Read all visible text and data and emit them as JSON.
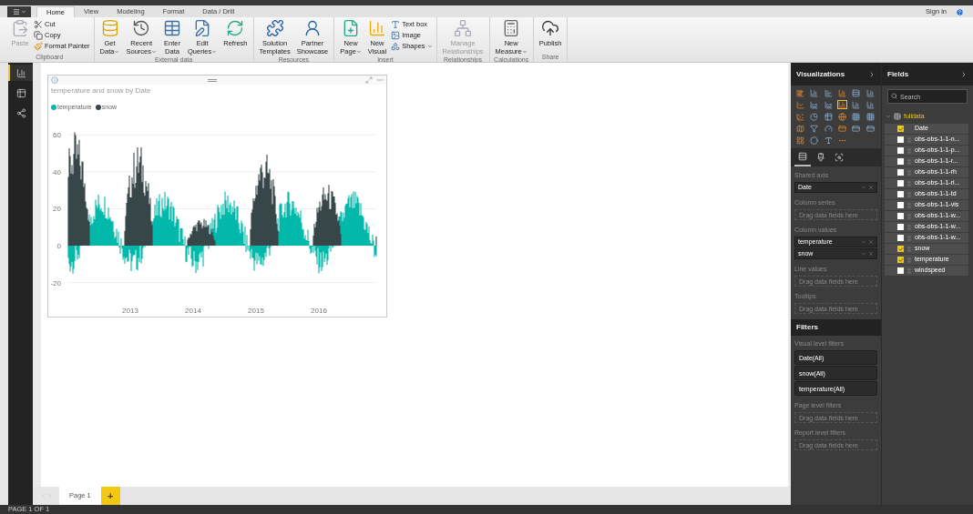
{
  "title_bar": {
    "sign_in": "Sign in"
  },
  "tabs": [
    {
      "label": "Home",
      "selected": true
    },
    {
      "label": "View",
      "selected": false
    },
    {
      "label": "Modeling",
      "selected": false
    },
    {
      "label": "Format",
      "selected": false
    },
    {
      "label": "Data / Drill",
      "selected": false
    }
  ],
  "ribbon": [
    {
      "label": "Clipboard",
      "items": [
        {
          "kind": "large",
          "lines": [
            "Paste"
          ],
          "dropdown": false,
          "disabled": true
        },
        {
          "kind": "small",
          "lines": [
            "Cut"
          ],
          "dropdown": false,
          "disabled": false
        },
        {
          "kind": "small",
          "lines": [
            "Copy"
          ],
          "dropdown": false,
          "disabled": false
        },
        {
          "kind": "small",
          "lines": [
            "Format Painter"
          ],
          "dropdown": false,
          "disabled": false
        }
      ]
    },
    {
      "label": "External data",
      "items": [
        {
          "kind": "large",
          "lines": [
            "Get",
            "Data"
          ],
          "dropdown": true,
          "disabled": false
        },
        {
          "kind": "large",
          "lines": [
            "Recent",
            "Sources"
          ],
          "dropdown": true,
          "disabled": false
        },
        {
          "kind": "large",
          "lines": [
            "Enter",
            "Data"
          ],
          "dropdown": false,
          "disabled": false
        },
        {
          "kind": "large",
          "lines": [
            "Edit",
            "Queries"
          ],
          "dropdown": true,
          "disabled": false
        },
        {
          "kind": "large",
          "lines": [
            "Refresh"
          ],
          "dropdown": false,
          "disabled": false
        }
      ]
    },
    {
      "label": "Resources",
      "items": [
        {
          "kind": "large",
          "lines": [
            "Solution",
            "Templates"
          ],
          "dropdown": false,
          "disabled": false
        },
        {
          "kind": "large",
          "lines": [
            "Partner",
            "Showcase"
          ],
          "dropdown": false,
          "disabled": false
        }
      ]
    },
    {
      "label": "Insert",
      "items": [
        {
          "kind": "large",
          "lines": [
            "New",
            "Page"
          ],
          "dropdown": true,
          "disabled": false
        },
        {
          "kind": "large",
          "lines": [
            "New",
            "Visual"
          ],
          "dropdown": false,
          "disabled": false
        },
        {
          "kind": "small",
          "lines": [
            "Text box"
          ],
          "dropdown": false,
          "disabled": false
        },
        {
          "kind": "small",
          "lines": [
            "Image"
          ],
          "dropdown": false,
          "disabled": false
        },
        {
          "kind": "small",
          "lines": [
            "Shapes"
          ],
          "dropdown": true,
          "disabled": false
        }
      ]
    },
    {
      "label": "Relationships",
      "items": [
        {
          "kind": "large",
          "lines": [
            "Manage",
            "Relationships"
          ],
          "dropdown": false,
          "disabled": true
        }
      ]
    },
    {
      "label": "Calculations",
      "items": [
        {
          "kind": "large",
          "lines": [
            "New",
            "Measure"
          ],
          "dropdown": true,
          "disabled": false
        }
      ]
    },
    {
      "label": "Share",
      "items": [
        {
          "kind": "large",
          "lines": [
            "Publish"
          ],
          "dropdown": false,
          "disabled": false
        }
      ]
    }
  ],
  "views": [
    {
      "selected": true
    },
    {
      "selected": false
    },
    {
      "selected": false
    }
  ],
  "visual": {
    "title": "temperature and snow by Date",
    "legend": [
      {
        "name": "temperature",
        "color": "#01b8aa"
      },
      {
        "name": "snow",
        "color": "#374649"
      }
    ],
    "yticks": [
      "60",
      "40",
      "20",
      "0",
      "-20"
    ],
    "xticks": [
      "2013",
      "2014",
      "2015",
      "2016"
    ]
  },
  "page_tabs": [
    {
      "label": "Page 1",
      "selected": true
    }
  ],
  "add_page": "+",
  "status_bar": "PAGE 1 OF 1",
  "visualizations": {
    "title": "Visualizations",
    "visual_types": [
      {
        "selected": false
      },
      {
        "selected": false
      },
      {
        "selected": false
      },
      {
        "selected": false
      },
      {
        "selected": false
      },
      {
        "selected": false
      },
      {
        "selected": false
      },
      {
        "selected": false
      },
      {
        "selected": false
      },
      {
        "selected": true
      },
      {
        "selected": false
      },
      {
        "selected": false
      },
      {
        "selected": false
      },
      {
        "selected": false
      },
      {
        "selected": false
      },
      {
        "selected": false
      },
      {
        "selected": false
      },
      {
        "selected": false
      },
      {
        "selected": false
      },
      {
        "selected": false
      },
      {
        "selected": false
      },
      {
        "selected": false
      },
      {
        "selected": false
      },
      {
        "selected": false
      },
      {
        "selected": false
      },
      {
        "selected": false
      },
      {
        "selected": false
      },
      {
        "selected": false
      }
    ],
    "pane_tabs": [
      {
        "selected": true
      },
      {
        "selected": false
      },
      {
        "selected": false
      }
    ],
    "wells": [
      {
        "label": "Shared axis",
        "fields": [
          "Date"
        ]
      },
      {
        "label": "Column series",
        "placeholder": "Drag data fields here"
      },
      {
        "label": "Column values",
        "fields": [
          "temperature",
          "snow"
        ]
      },
      {
        "label": "Line values",
        "placeholder": "Drag data fields here"
      },
      {
        "label": "Tooltips",
        "placeholder": "Drag data fields here"
      }
    ]
  },
  "filters": {
    "title": "Filters",
    "sections": [
      {
        "label": "Visual level filters",
        "filters": [
          "Date(All)",
          "snow(All)",
          "temperature(All)"
        ]
      },
      {
        "label": "Page level filters",
        "placeholder": "Drag data fields here"
      },
      {
        "label": "Report level filters",
        "placeholder": "Drag data fields here"
      }
    ]
  },
  "fields": {
    "title": "Fields",
    "search": {
      "placeholder": "Search"
    },
    "table": {
      "name": "fulldata",
      "expanded": true,
      "children": [
        {
          "name": "Date",
          "kind": "date",
          "checked": true
        },
        {
          "name": "obs-obs-1-1-n...",
          "kind": "numeric",
          "checked": false
        },
        {
          "name": "obs-obs-1-1-p...",
          "kind": "numeric",
          "checked": false
        },
        {
          "name": "obs-obs-1-1-r...",
          "kind": "numeric",
          "checked": false
        },
        {
          "name": "obs-obs-1-1-rh",
          "kind": "numeric",
          "checked": false
        },
        {
          "name": "obs-obs-1-1-ri...",
          "kind": "numeric",
          "checked": false
        },
        {
          "name": "obs-obs-1-1-td",
          "kind": "numeric",
          "checked": false
        },
        {
          "name": "obs-obs-1-1-vis",
          "kind": "numeric",
          "checked": false
        },
        {
          "name": "obs-obs-1-1-w...",
          "kind": "numeric",
          "checked": false
        },
        {
          "name": "obs-obs-1-1-w...",
          "kind": "numeric",
          "checked": false
        },
        {
          "name": "obs-obs-1-1-w...",
          "kind": "numeric",
          "checked": false
        },
        {
          "name": "snow",
          "kind": "numeric",
          "checked": true
        },
        {
          "name": "temperature",
          "kind": "numeric",
          "checked": true
        },
        {
          "name": "windspeed",
          "kind": "numeric",
          "checked": false
        }
      ]
    }
  }
}
